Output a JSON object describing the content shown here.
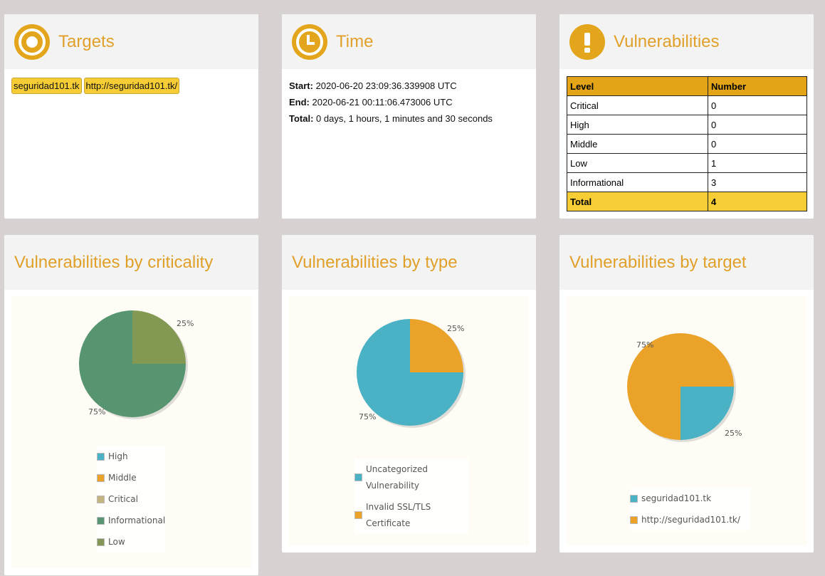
{
  "targets": {
    "title": "Targets",
    "icon": "target-icon",
    "items": [
      "seguridad101.tk",
      "http://seguridad101.tk/"
    ]
  },
  "time": {
    "title": "Time",
    "icon": "clock-icon",
    "start_label": "Start:",
    "start_value": "2020-06-20 23:09:36.339908 UTC",
    "end_label": "End:",
    "end_value": "2020-06-21 00:11:06.473006 UTC",
    "total_label": "Total:",
    "total_value": "0 days, 1 hours, 1 minutes and 30 seconds"
  },
  "vulnerabilities": {
    "title": "Vulnerabilities",
    "icon": "exclamation-icon",
    "headers": [
      "Level",
      "Number"
    ],
    "rows": [
      {
        "level": "Critical",
        "number": "0"
      },
      {
        "level": "High",
        "number": "0"
      },
      {
        "level": "Middle",
        "number": "0"
      },
      {
        "level": "Low",
        "number": "1"
      },
      {
        "level": "Informational",
        "number": "3"
      }
    ],
    "total_label": "Total",
    "total_value": "4"
  },
  "charts": {
    "criticality_title": "Vulnerabilities by criticality",
    "type_title": "Vulnerabilities by type",
    "target_title": "Vulnerabilities by target"
  },
  "chart_data": [
    {
      "type": "pie",
      "categories": [
        "Low",
        "Informational"
      ],
      "values": [
        25,
        75
      ],
      "labels": [
        "25%",
        "75%"
      ],
      "colors": [
        "#839853",
        "#579470"
      ],
      "legend": [
        {
          "name": "High",
          "color": "#4bb2c5"
        },
        {
          "name": "Middle",
          "color": "#eaa228"
        },
        {
          "name": "Critical",
          "color": "#c5b47f"
        },
        {
          "name": "Informational",
          "color": "#579575"
        },
        {
          "name": "Low",
          "color": "#839557"
        }
      ]
    },
    {
      "type": "pie",
      "categories": [
        "Invalid SSL/TLS Certificate",
        "Uncategorized Vulnerability"
      ],
      "values": [
        25,
        75
      ],
      "labels": [
        "25%",
        "75%"
      ],
      "colors": [
        "#eaa228",
        "#4bb2c5"
      ],
      "legend": [
        {
          "name": "Uncategorized",
          "name2": "Vulnerability",
          "color": "#4bb2c5"
        },
        {
          "name": "Invalid SSL/TLS",
          "name2": "Certificate",
          "color": "#eaa228"
        }
      ]
    },
    {
      "type": "pie",
      "categories": [
        "seguridad101.tk",
        "http://seguridad101.tk/"
      ],
      "values": [
        25,
        75
      ],
      "labels": [
        "25%",
        "75%"
      ],
      "colors": [
        "#4bb2c5",
        "#eaa228"
      ],
      "legend": [
        {
          "name": "seguridad101.tk",
          "color": "#4bb2c5"
        },
        {
          "name": "http://seguridad101.tk/",
          "color": "#eaa228"
        }
      ]
    }
  ]
}
